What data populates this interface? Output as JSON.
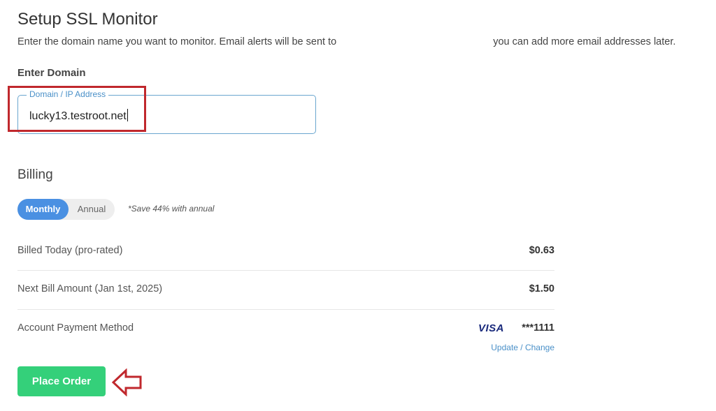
{
  "page": {
    "title": "Setup SSL Monitor",
    "intro_before": "Enter the domain name you want to monitor. Email alerts will be sent to",
    "intro_after": "you can add more email addresses later."
  },
  "domain_section": {
    "label": "Enter Domain",
    "field_legend": "Domain / IP Address",
    "field_value": "lucky13.testroot.net"
  },
  "billing": {
    "heading": "Billing",
    "toggle": {
      "monthly": "Monthly",
      "annual": "Annual",
      "selected": "Monthly"
    },
    "save_note": "*Save 44% with annual",
    "rows": [
      {
        "label": "Billed Today (pro-rated)",
        "value": "$0.63"
      },
      {
        "label": "Next Bill Amount (Jan 1st, 2025)",
        "value": "$1.50"
      },
      {
        "label": "Account Payment Method",
        "value": "***1111"
      }
    ],
    "card_brand": "VISA",
    "update_link": "Update / Change"
  },
  "actions": {
    "place_order": "Place Order"
  },
  "colors": {
    "accent_blue": "#4a90e2",
    "button_green": "#34d07a",
    "annotation_red": "#c0282d",
    "visa_navy": "#1a2a7c"
  },
  "icons": {
    "order_pointer": "left-arrow-icon"
  }
}
